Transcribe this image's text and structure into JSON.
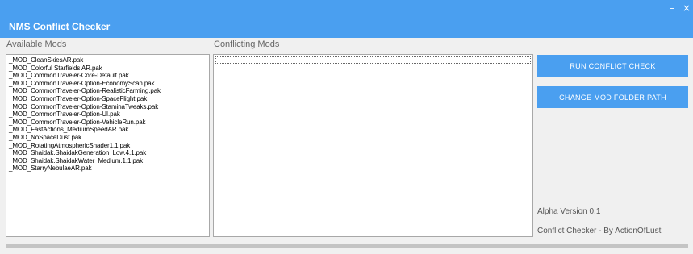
{
  "window": {
    "minimize_glyph": "–",
    "close_glyph": "×"
  },
  "app": {
    "title": "NMS Conflict Checker"
  },
  "available": {
    "label": "Available Mods",
    "items": [
      "_MOD_CleanSkiesAR.pak",
      "_MOD_Colorful Starfields AR.pak",
      "_MOD_CommonTraveler-Core-Default.pak",
      "_MOD_CommonTraveler-Option-EconomyScan.pak",
      "_MOD_CommonTraveler-Option-RealisticFarming.pak",
      "_MOD_CommonTraveler-Option-SpaceFlight.pak",
      "_MOD_CommonTraveler-Option-StaminaTweaks.pak",
      "_MOD_CommonTraveler-Option-UI.pak",
      "_MOD_CommonTraveler-Option-VehicleRun.pak",
      "_MOD_FastActions_MediumSpeedAR.pak",
      "_MOD_NoSpaceDust.pak",
      "_MOD_RotatingAtmosphericShader1.1.pak",
      "_MOD_Shaidak.ShaidakGeneration_Low.4.1.pak",
      "_MOD_Shaidak.ShaidakWater_Medium.1.1.pak",
      "_MOD_StarryNebulaeAR.pak"
    ]
  },
  "conflicting": {
    "label": "Conflicting Mods"
  },
  "actions": {
    "run_label": "RUN CONFLICT CHECK",
    "change_label": "CHANGE MOD FOLDER PATH"
  },
  "footer": {
    "version": "Alpha Version 0.1",
    "credit": "Conflict Checker - By ActionOfLust"
  }
}
